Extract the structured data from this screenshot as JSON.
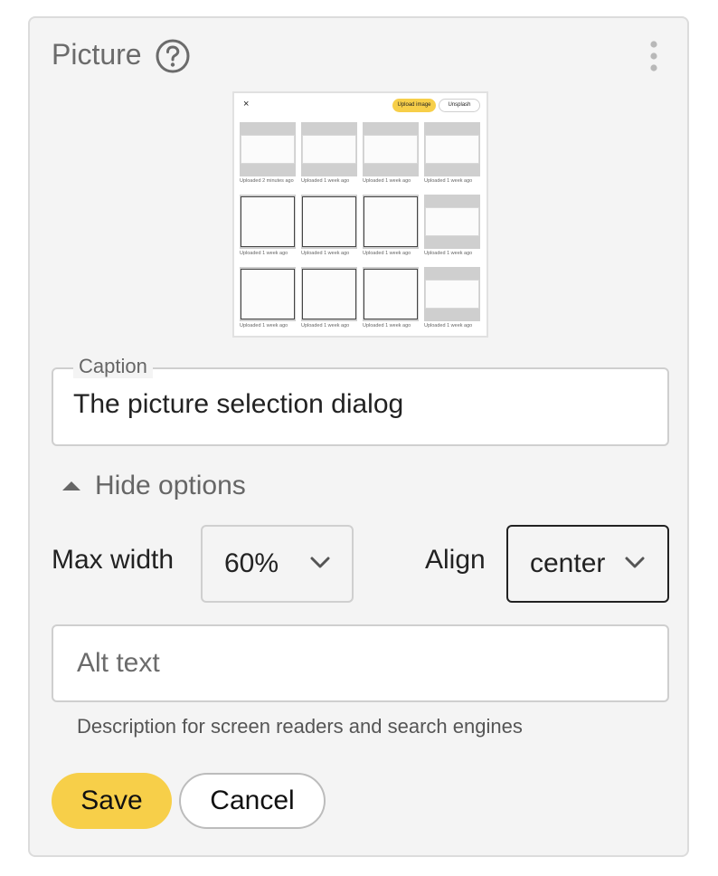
{
  "widget": {
    "title": "Picture"
  },
  "thumbnail": {
    "close": "×",
    "upload_label": "Upload image",
    "unsplash_label": "Unsplash",
    "captions": [
      "Uploaded 2 minutes ago",
      "Uploaded 1 week ago",
      "Uploaded 1 week ago",
      "Uploaded 1 week ago",
      "Uploaded 1 week ago",
      "Uploaded 1 week ago",
      "Uploaded 1 week ago",
      "Uploaded 1 week ago",
      "Uploaded 1 week ago",
      "Uploaded 1 week ago",
      "Uploaded 1 week ago",
      "Uploaded 1 week ago"
    ]
  },
  "caption": {
    "legend": "Caption",
    "value": "The picture selection dialog"
  },
  "options": {
    "toggle_label": "Hide options",
    "max_width_label": "Max width",
    "max_width_value": "60%",
    "align_label": "Align",
    "align_value": "center"
  },
  "alt_text": {
    "placeholder": "Alt text",
    "help": "Description for screen readers and search engines"
  },
  "buttons": {
    "save": "Save",
    "cancel": "Cancel"
  },
  "colors": {
    "accent": "#f7cf49",
    "panel_bg": "#f4f4f4",
    "border": "#cfcfcf"
  },
  "icons": {
    "help": "help-circle-icon",
    "menu": "kebab-menu-icon",
    "toggle": "triangle-up-icon",
    "dropdown": "chevron-down-icon"
  }
}
